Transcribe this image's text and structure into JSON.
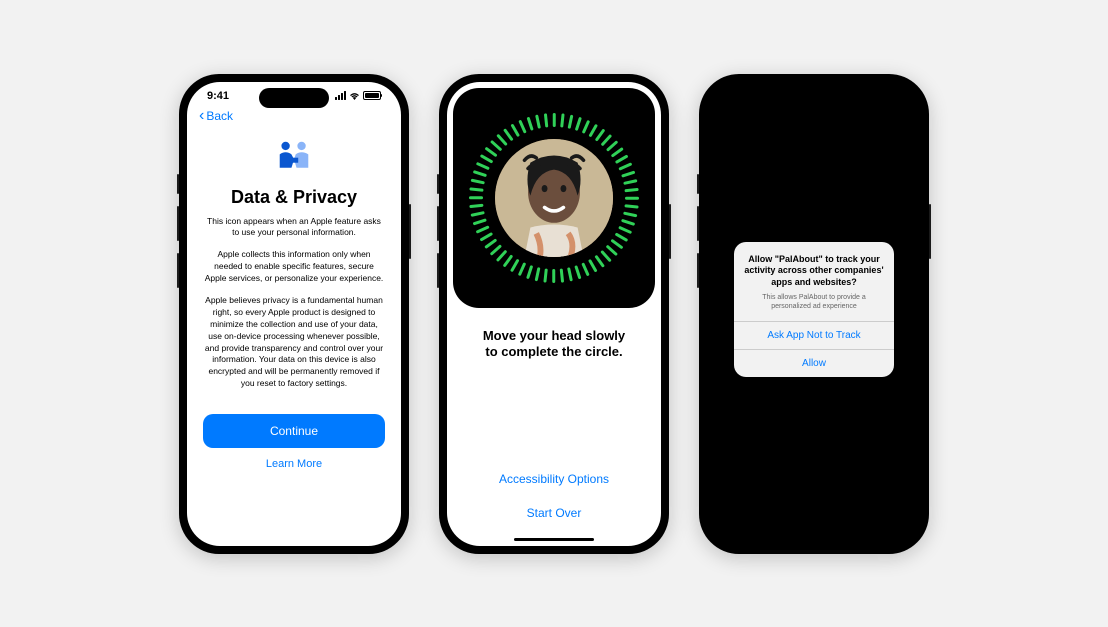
{
  "phone1": {
    "time": "9:41",
    "back_label": "Back",
    "title": "Data & Privacy",
    "para1": "This icon appears when an Apple feature asks to use your personal information.",
    "para2": "Apple collects this information only when needed to enable specific features, secure Apple services, or personalize your experience.",
    "para3": "Apple believes privacy is a fundamental human right, so every Apple product is designed to minimize the collection and use of your data, use on-device processing whenever possible, and provide transparency and control over your information. Your data on this device is also encrypted and will be permanently removed if you reset to factory settings.",
    "continue_label": "Continue",
    "learn_more_label": "Learn More"
  },
  "phone2": {
    "instruction": "Move your head slowly to complete the circle.",
    "accessibility_label": "Accessibility Options",
    "start_over_label": "Start Over"
  },
  "phone3": {
    "dialog_title": "Allow \"PalAbout\" to track your activity across other companies' apps and websites?",
    "dialog_subtitle": "This allows PalAbout to provide a personalized ad experience",
    "deny_label": "Ask App Not to Track",
    "allow_label": "Allow"
  }
}
